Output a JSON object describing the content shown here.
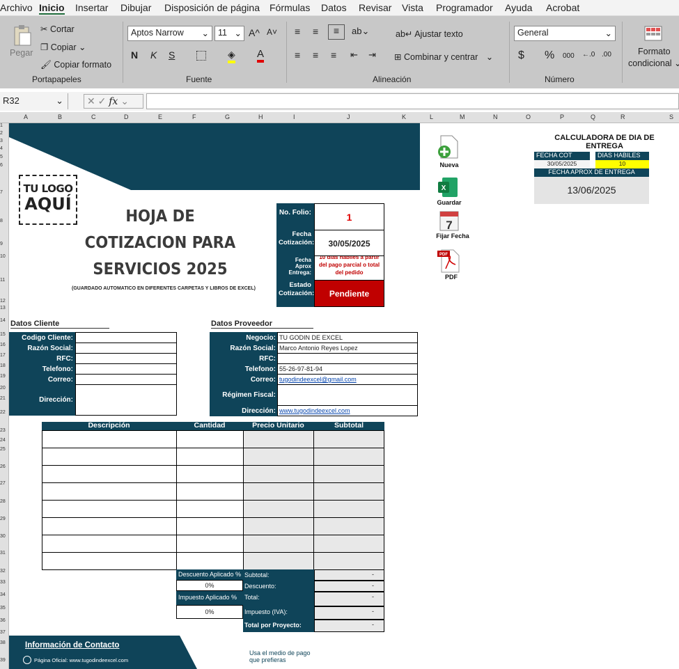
{
  "menu": [
    "Archivo",
    "Inicio",
    "Insertar",
    "Dibujar",
    "Disposición de página",
    "Fórmulas",
    "Datos",
    "Revisar",
    "Vista",
    "Programador",
    "Ayuda",
    "Acrobat"
  ],
  "ribbon": {
    "portapapeles": {
      "paste": "Pegar",
      "cut": "Cortar",
      "copy": "Copiar",
      "format_painter": "Copiar formato",
      "label": "Portapapeles"
    },
    "fuente": {
      "font": "Aptos Narrow",
      "size": "11",
      "label": "Fuente"
    },
    "alineacion": {
      "wrap": "Ajustar texto",
      "merge": "Combinar y centrar",
      "label": "Alineación"
    },
    "numero": {
      "format": "General",
      "label": "Número"
    },
    "estilos": {
      "cond_line1": "Formato",
      "cond_line2": "condicional"
    }
  },
  "formula_bar": {
    "name_box": "R32",
    "fx": "fx"
  },
  "columns": [
    "A",
    "B",
    "C",
    "D",
    "E",
    "F",
    "G",
    "H",
    "I",
    "J",
    "K",
    "L",
    "M",
    "N",
    "O",
    "P",
    "Q",
    "R",
    "S"
  ],
  "rows": [
    "1",
    "2",
    "3",
    "4",
    "5",
    "6",
    "7",
    "8",
    "9",
    "10",
    "11",
    "12",
    "13",
    "14",
    "15",
    "16",
    "17",
    "18",
    "19",
    "20",
    "21",
    "22",
    "23",
    "24",
    "25",
    "26",
    "27",
    "28",
    "29",
    "30",
    "31",
    "32",
    "33",
    "34",
    "35",
    "36",
    "37",
    "38",
    "39"
  ],
  "logo": {
    "line1": "TU LOGO",
    "line2": "AQUÍ"
  },
  "title": {
    "line1": "HOJA DE",
    "line2": "COTIZACION PARA",
    "line3": "SERVICIOS  2025",
    "subtitle": "(GUARDADO AUTOMATICO EN DIFERENTES CARPETAS Y LIBROS DE EXCEL)"
  },
  "folio": {
    "no_label": "No. Folio:",
    "no_value": "1",
    "fecha_label": "Fecha Cotización:",
    "fecha_value": "30/05/2025",
    "aprox_label": "Fecha Aprox Entrega:",
    "aprox_value": "10 dias habiles a partir del pago parcial o total del pedido",
    "estado_label": "Estado Cotización:",
    "estado_value": "Pendiente"
  },
  "actions": [
    {
      "label": "Nueva"
    },
    {
      "label": "Guardar"
    },
    {
      "label": "Fijar Fecha"
    },
    {
      "label": "PDF"
    }
  ],
  "calc": {
    "title": "CALCULADORA DE DIA DE ENTREGA",
    "fecha_cot_label": "FECHA COT",
    "fecha_cot_value": "30/05/2025",
    "dias_label": "DIAS HABILES",
    "dias_value": "10",
    "aprox_label": "FECHA APROX DE ENTREGA",
    "aprox_value": "13/06/2025"
  },
  "cliente": {
    "title": "Datos Cliente",
    "fields": [
      "Codigo Cliente:",
      "Razón Social:",
      "RFC:",
      "Telefono:",
      "Correo:",
      "Dirección:"
    ]
  },
  "proveedor": {
    "title": "Datos Proveedor",
    "fields": [
      "Negocio:",
      "Razón Social:",
      "RFC:",
      "Telefono:",
      "Correo:",
      "Régimen Fiscal:",
      "Dirección:"
    ],
    "values": [
      "TU GODIN DE EXCEL",
      "Marco Antonio Reyes Lopez",
      "",
      "55-26-97-81-94",
      "tugodindeexcel@gmail.com",
      "",
      "www.tugodindeexcel.com"
    ]
  },
  "table": {
    "headers": [
      "Descripción",
      "Cantidad",
      "Precio Unitario",
      "Subtotal"
    ]
  },
  "totals": {
    "descuento_label": "Descuento Aplicado %",
    "descuento_value": "0%",
    "impuesto_label": "Impuesto Aplicado %",
    "impuesto_value": "0%",
    "rows": [
      {
        "label": "Subtotal:",
        "value": "-"
      },
      {
        "label": "Descuento:",
        "value": "-"
      },
      {
        "label": "Total:",
        "value": "-"
      },
      {
        "label": "Impuesto (IVA):",
        "value": "-"
      },
      {
        "label": "Total por Proyecto:",
        "value": "-"
      }
    ]
  },
  "footer": {
    "contact_title": "Información de Contacto",
    "web": "Página Oficial: www.tugodindeexcel.com",
    "pay_line1": "Usa el medio de pago",
    "pay_line2": "que prefieras"
  },
  "colors": {
    "navy": "#0f4459",
    "red": "#c00000",
    "yellow": "#ffff00",
    "grey_cell": "#e8e8e8"
  }
}
